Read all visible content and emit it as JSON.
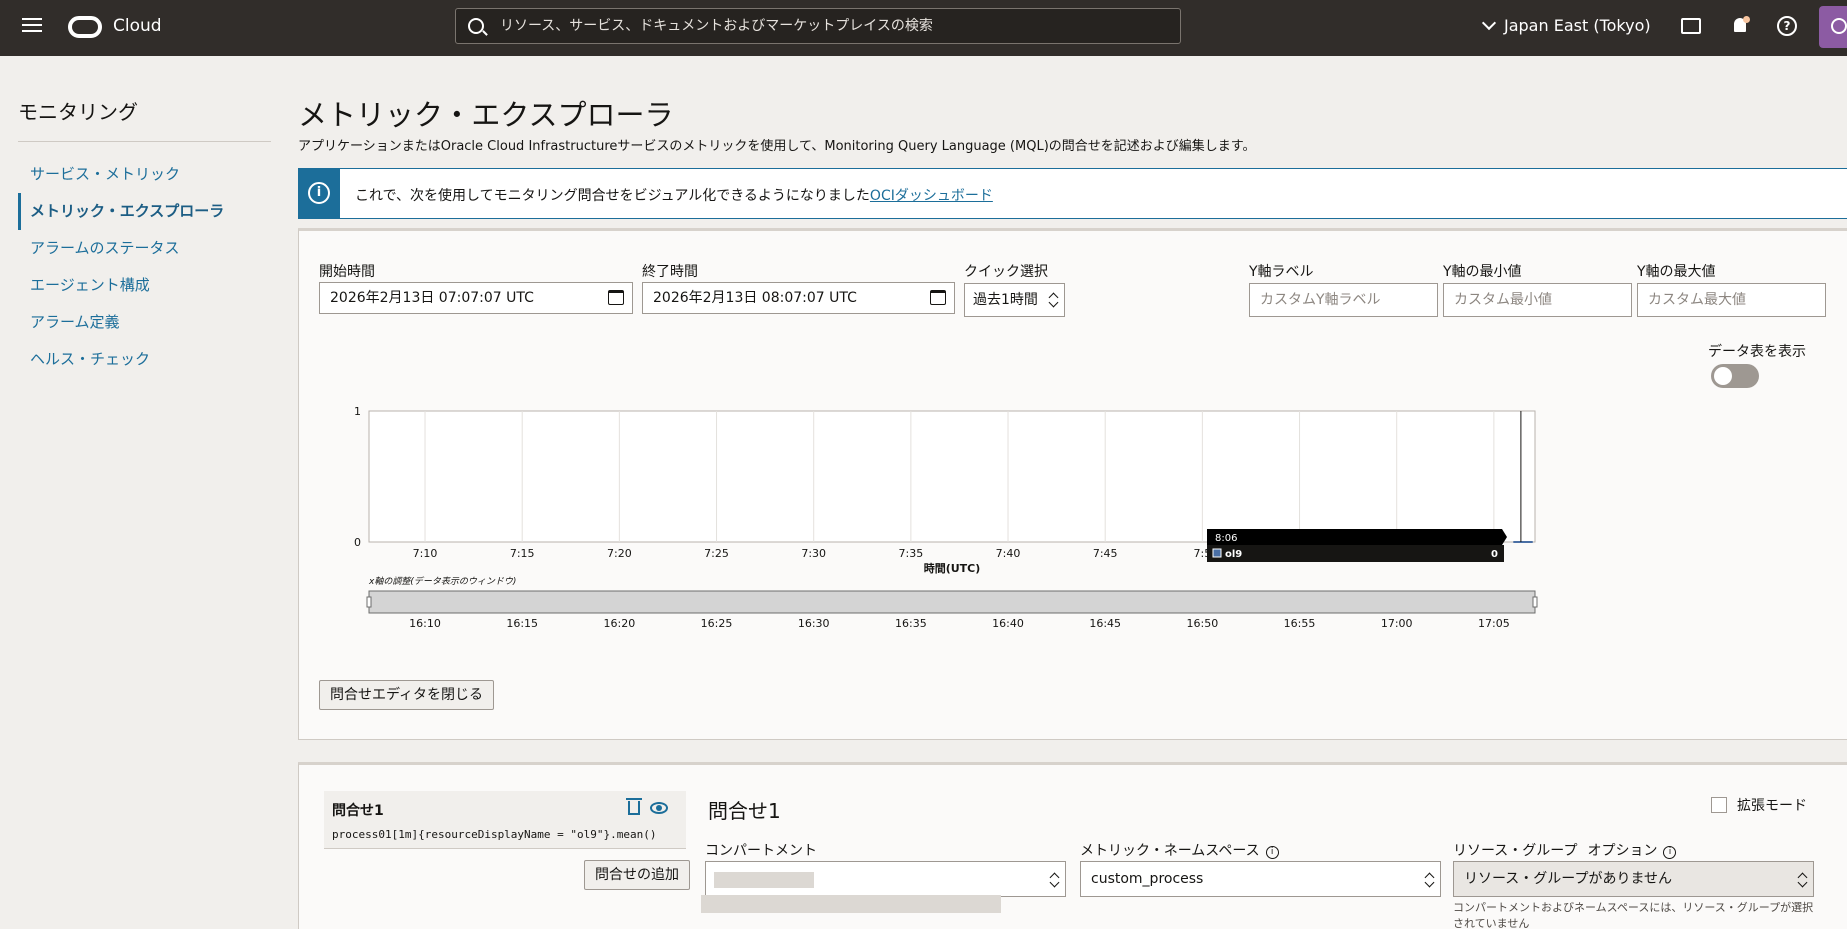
{
  "topbar": {
    "brand": "Cloud",
    "search_placeholder": "リソース、サービス、ドキュメントおよびマーケットプレイスの検索",
    "region": "Japan East (Tokyo)",
    "help_glyph": "?"
  },
  "sidebar": {
    "title": "モニタリング",
    "items": [
      {
        "label": "サービス・メトリック"
      },
      {
        "label": "メトリック・エクスプローラ"
      },
      {
        "label": "アラームのステータス"
      },
      {
        "label": "エージェント構成"
      },
      {
        "label": "アラーム定義"
      },
      {
        "label": "ヘルス・チェック"
      }
    ]
  },
  "main": {
    "title": "メトリック・エクスプローラ",
    "description": "アプリケーションまたはOracle Cloud Infrastructureサービスのメトリックを使用して、Monitoring Query Language (MQL)の問合せを記述および編集します。",
    "banner": {
      "icon": "i",
      "text": "これで、次を使用してモニタリング問合せをビジュアル化できるようになりました",
      "link": "OCIダッシュボード"
    }
  },
  "controls": {
    "start_label": "開始時間",
    "start_value": "2026年2月13日 07:07:07 UTC",
    "end_label": "終了時間",
    "end_value": "2026年2月13日 08:07:07 UTC",
    "quick_label": "クイック選択",
    "quick_value": "過去1時間",
    "ylabel_label": "Y軸ラベル",
    "ylabel_placeholder": "カスタムY軸ラベル",
    "ymin_label": "Y軸の最小値",
    "ymin_placeholder": "カスタム最小値",
    "ymax_label": "Y軸の最大値",
    "ymax_placeholder": "カスタム最大値",
    "data_table_label": "データ表を表示",
    "data_table_on": false,
    "close_editor": "問合せエディタを閉じる"
  },
  "chart_data": {
    "type": "line",
    "xlabel": "時間(UTC)",
    "x_ticks": [
      "7:10",
      "7:15",
      "7:20",
      "7:25",
      "7:30",
      "7:35",
      "7:40",
      "7:45",
      "7:5"
    ],
    "y_ticks": [
      "1",
      "0"
    ],
    "ylim": [
      0,
      1
    ],
    "grid": true,
    "series": [
      {
        "name": "ol9",
        "color": "#4a6fa5",
        "points": [
          {
            "x": "8:06",
            "y": 0
          },
          {
            "x": "8:07",
            "y": 0
          }
        ]
      }
    ],
    "tooltip": {
      "time": "8:06",
      "series": "ol9",
      "value": "0"
    },
    "brush_label": "x軸の調整(データ表示のウィンドウ)",
    "brush_ticks": [
      "16:10",
      "16:15",
      "16:20",
      "16:25",
      "16:30",
      "16:35",
      "16:40",
      "16:45",
      "16:50",
      "16:55",
      "17:00",
      "17:05"
    ]
  },
  "query": {
    "card_name": "問合せ1",
    "card_expr": "process01[1m]{resourceDisplayName = \"ol9\"}.mean()",
    "add_button": "問合せの追加",
    "title": "問合せ1",
    "extended_mode": "拡張モード",
    "compartment_label": "コンパートメント",
    "namespace_label": "メトリック・ネームスペース",
    "namespace_value": "custom_process",
    "resource_group_label": "リソース・グループ",
    "resource_group_optional": "オプション",
    "resource_group_value": "リソース・グループがありません",
    "resource_group_help": "コンパートメントおよびネームスペースには、リソース・グループが選択されていません",
    "info_glyph": "i"
  }
}
